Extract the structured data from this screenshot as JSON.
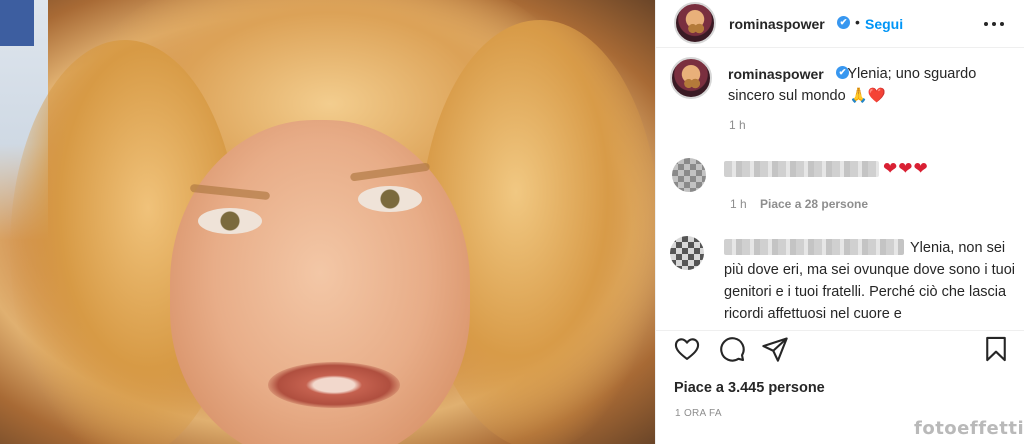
{
  "post": {
    "photo_alt": "Ritratto"
  },
  "header": {
    "username": "rominaspower",
    "verified_mark": "✔",
    "separator": "•",
    "follow_label": "Segui",
    "more_icon": "more-horizontal-icon"
  },
  "caption": {
    "username": "rominaspower",
    "verified_mark": "✔",
    "text": "Ylenia; uno sguardo sincero sul mondo 🙏❤️",
    "timestamp": "1 h"
  },
  "comments": [
    {
      "text": "❤❤❤",
      "timestamp": "1 h",
      "likes_label": "Piace a 28 persone"
    },
    {
      "text": "Ylenia, non sei più dove eri, ma sei ovunque dove sono i tuoi genitori e i tuoi fratelli. Perché ciò che lascia ricordi affettuosi nel cuore e"
    }
  ],
  "actions": {
    "like_icon": "heart-icon",
    "comment_icon": "comment-icon",
    "share_icon": "send-icon",
    "save_icon": "bookmark-icon"
  },
  "footer": {
    "likes": "Piace a 3.445 persone",
    "posted": "1 ORA FA"
  },
  "watermark": "fotoeffetti",
  "colors": {
    "link_blue": "#0095f6",
    "verified_blue": "#3897f0",
    "heart_red": "#d92033"
  }
}
